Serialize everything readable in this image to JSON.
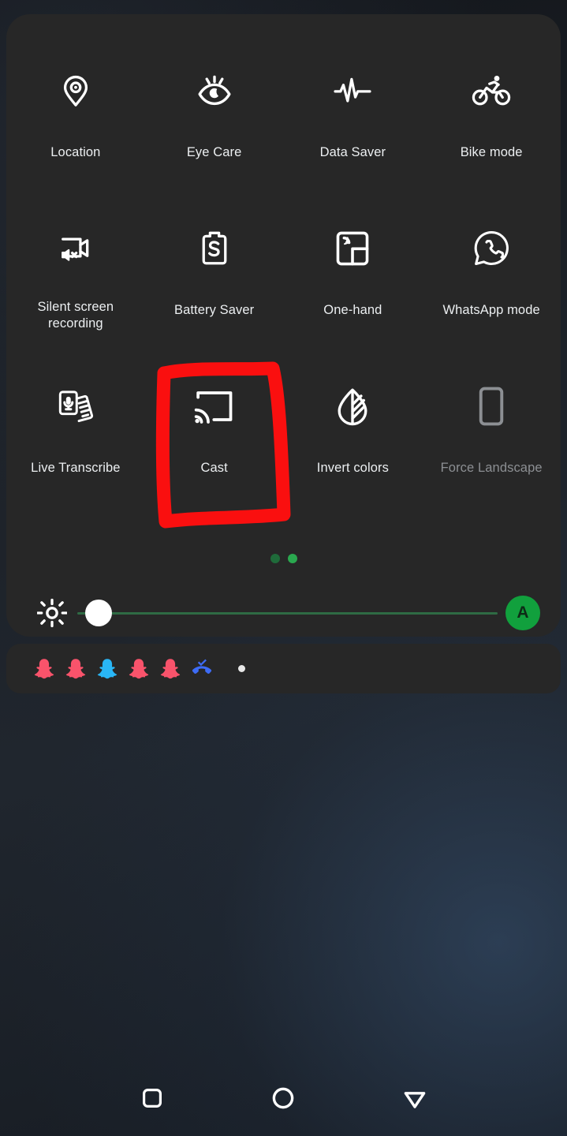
{
  "panel": {
    "name": "quick-settings-panel",
    "background_color": "#272727",
    "tiles": [
      {
        "label": "Location",
        "icon": "location-pin-icon",
        "state": "enabled"
      },
      {
        "label": "Eye Care",
        "icon": "eye-care-icon",
        "state": "enabled"
      },
      {
        "label": "Data Saver",
        "icon": "data-saver-pulse-icon",
        "state": "enabled"
      },
      {
        "label": "Bike mode",
        "icon": "bicycle-icon",
        "state": "enabled"
      },
      {
        "label": "Silent screen\nrecording",
        "icon": "silent-screen-record-icon",
        "state": "enabled"
      },
      {
        "label": "Battery Saver",
        "icon": "battery-saver-icon",
        "state": "enabled"
      },
      {
        "label": "One-hand",
        "icon": "one-hand-mode-icon",
        "state": "enabled"
      },
      {
        "label": "WhatsApp mode",
        "icon": "whatsapp-mode-icon",
        "state": "enabled"
      },
      {
        "label": "Live Transcribe",
        "icon": "live-transcribe-icon",
        "state": "enabled"
      },
      {
        "label": "Cast",
        "icon": "cast-icon",
        "state": "enabled"
      },
      {
        "label": "Invert colors",
        "icon": "invert-colors-icon",
        "state": "enabled"
      },
      {
        "label": "Force Landscape",
        "icon": "force-landscape-icon",
        "state": "disabled"
      }
    ],
    "page_indicator": {
      "total_pages": 2,
      "active_page": 2,
      "active_color": "#2aa84f",
      "inactive_color": "#1f6b3a"
    },
    "brightness": {
      "icon": "brightness-sun-icon",
      "value_percent": 2,
      "track_color": "#2e6b44",
      "thumb_color": "#ffffff",
      "auto_button_label": "A",
      "auto_button_color": "#11a03d",
      "auto_enabled": true
    }
  },
  "notification_shelf": {
    "name": "notification-shelf",
    "icons": [
      {
        "icon": "snapchat-ghost-icon",
        "color": "#f9536b"
      },
      {
        "icon": "snapchat-ghost-icon",
        "color": "#f9536b"
      },
      {
        "icon": "snapchat-ghost-icon",
        "color": "#29b6f6"
      },
      {
        "icon": "snapchat-ghost-icon",
        "color": "#f9536b"
      },
      {
        "icon": "snapchat-ghost-icon",
        "color": "#f9536b"
      },
      {
        "icon": "call-answered-icon",
        "color": "#3d6bf5"
      }
    ],
    "overflow_dot_color": "#e8e8e8"
  },
  "annotation": {
    "name": "red-highlight-box",
    "shape": "hand-drawn-rectangle",
    "color": "#fa0f0f",
    "targets_tile": "Cast"
  },
  "navbar": {
    "buttons": [
      {
        "icon": "recents-square-icon",
        "name": "recents-button"
      },
      {
        "icon": "home-circle-icon",
        "name": "home-button"
      },
      {
        "icon": "back-triangle-icon",
        "name": "back-button"
      }
    ]
  }
}
